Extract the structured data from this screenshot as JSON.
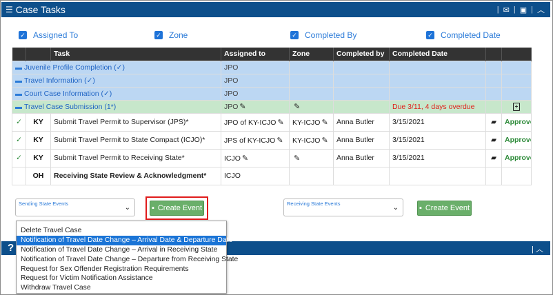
{
  "header": {
    "title": "Case Tasks",
    "icons": [
      "list-icon",
      "mail-icon",
      "print-icon",
      "chevron-up-icon"
    ]
  },
  "filters": [
    {
      "label": "Assigned To",
      "checked": true
    },
    {
      "label": "Zone",
      "checked": true
    },
    {
      "label": "Completed By",
      "checked": true
    },
    {
      "label": "Completed Date",
      "checked": true
    }
  ],
  "table": {
    "columns": [
      "",
      "",
      "Task",
      "Assigned to",
      "Zone",
      "Completed by",
      "Completed Date",
      "",
      ""
    ],
    "phases": [
      {
        "name": "Juvenile Profile Completion (✓)",
        "assigned": "JPO"
      },
      {
        "name": "Travel Information (✓)",
        "assigned": "JPO"
      },
      {
        "name": "Court Case Information (✓)",
        "assigned": "JPO"
      }
    ],
    "active_phase": {
      "name": "Travel Case Submission (1*)",
      "assigned": "JPO",
      "due": "Due 3/11, 4 days overdue"
    },
    "tasks": [
      {
        "done": true,
        "state": "KY",
        "task": "Submit Travel Permit to Supervisor (JPS)*",
        "assigned": "JPO of KY-ICJO",
        "zone": "KY-ICJO",
        "completed_by": "Anna Butler",
        "completed_date": "3/15/2021",
        "status": "Approved"
      },
      {
        "done": true,
        "state": "KY",
        "task": "Submit Travel Permit to State Compact (ICJO)*",
        "assigned": "JPS of KY-ICJO",
        "zone": "KY-ICJO",
        "completed_by": "Anna Butler",
        "completed_date": "3/15/2021",
        "status": "Approved"
      },
      {
        "done": true,
        "state": "KY",
        "task": "Submit Travel Permit to Receiving State*",
        "assigned": "ICJO",
        "zone": "",
        "completed_by": "Anna Butler",
        "completed_date": "3/15/2021",
        "status": "Approved"
      },
      {
        "done": false,
        "state": "OH",
        "task": "Receiving State Review & Acknowledgment*",
        "assigned": "ICJO",
        "zone": "",
        "completed_by": "",
        "completed_date": "",
        "status": ""
      }
    ]
  },
  "events": {
    "sending_label": "Sending State Events",
    "receiving_label": "Receiving State Events",
    "create_button": "Create Event"
  },
  "dropdown": {
    "options": [
      "Delete Travel Case",
      "Notification of Travel Date Change – Arrival Date & Departure Date",
      "Notification of Travel Date Change – Arrival in Receiving State",
      "Notification of Travel Date Change – Departure from Receiving State",
      "Request for Sex Offender Registration Requirements",
      "Request for Victim Notification Assistance",
      "Withdraw Travel Case"
    ],
    "selected_index": 1
  },
  "panel2": {
    "icon": "?"
  },
  "colors": {
    "header": "#0d4f8b",
    "phase_blue": "#bcd7f3",
    "phase_green": "#c7e7cb",
    "approved": "#2e8b3a",
    "overdue": "#e0201a",
    "button": "#6aaf6a",
    "highlight": "#e01b1b"
  }
}
